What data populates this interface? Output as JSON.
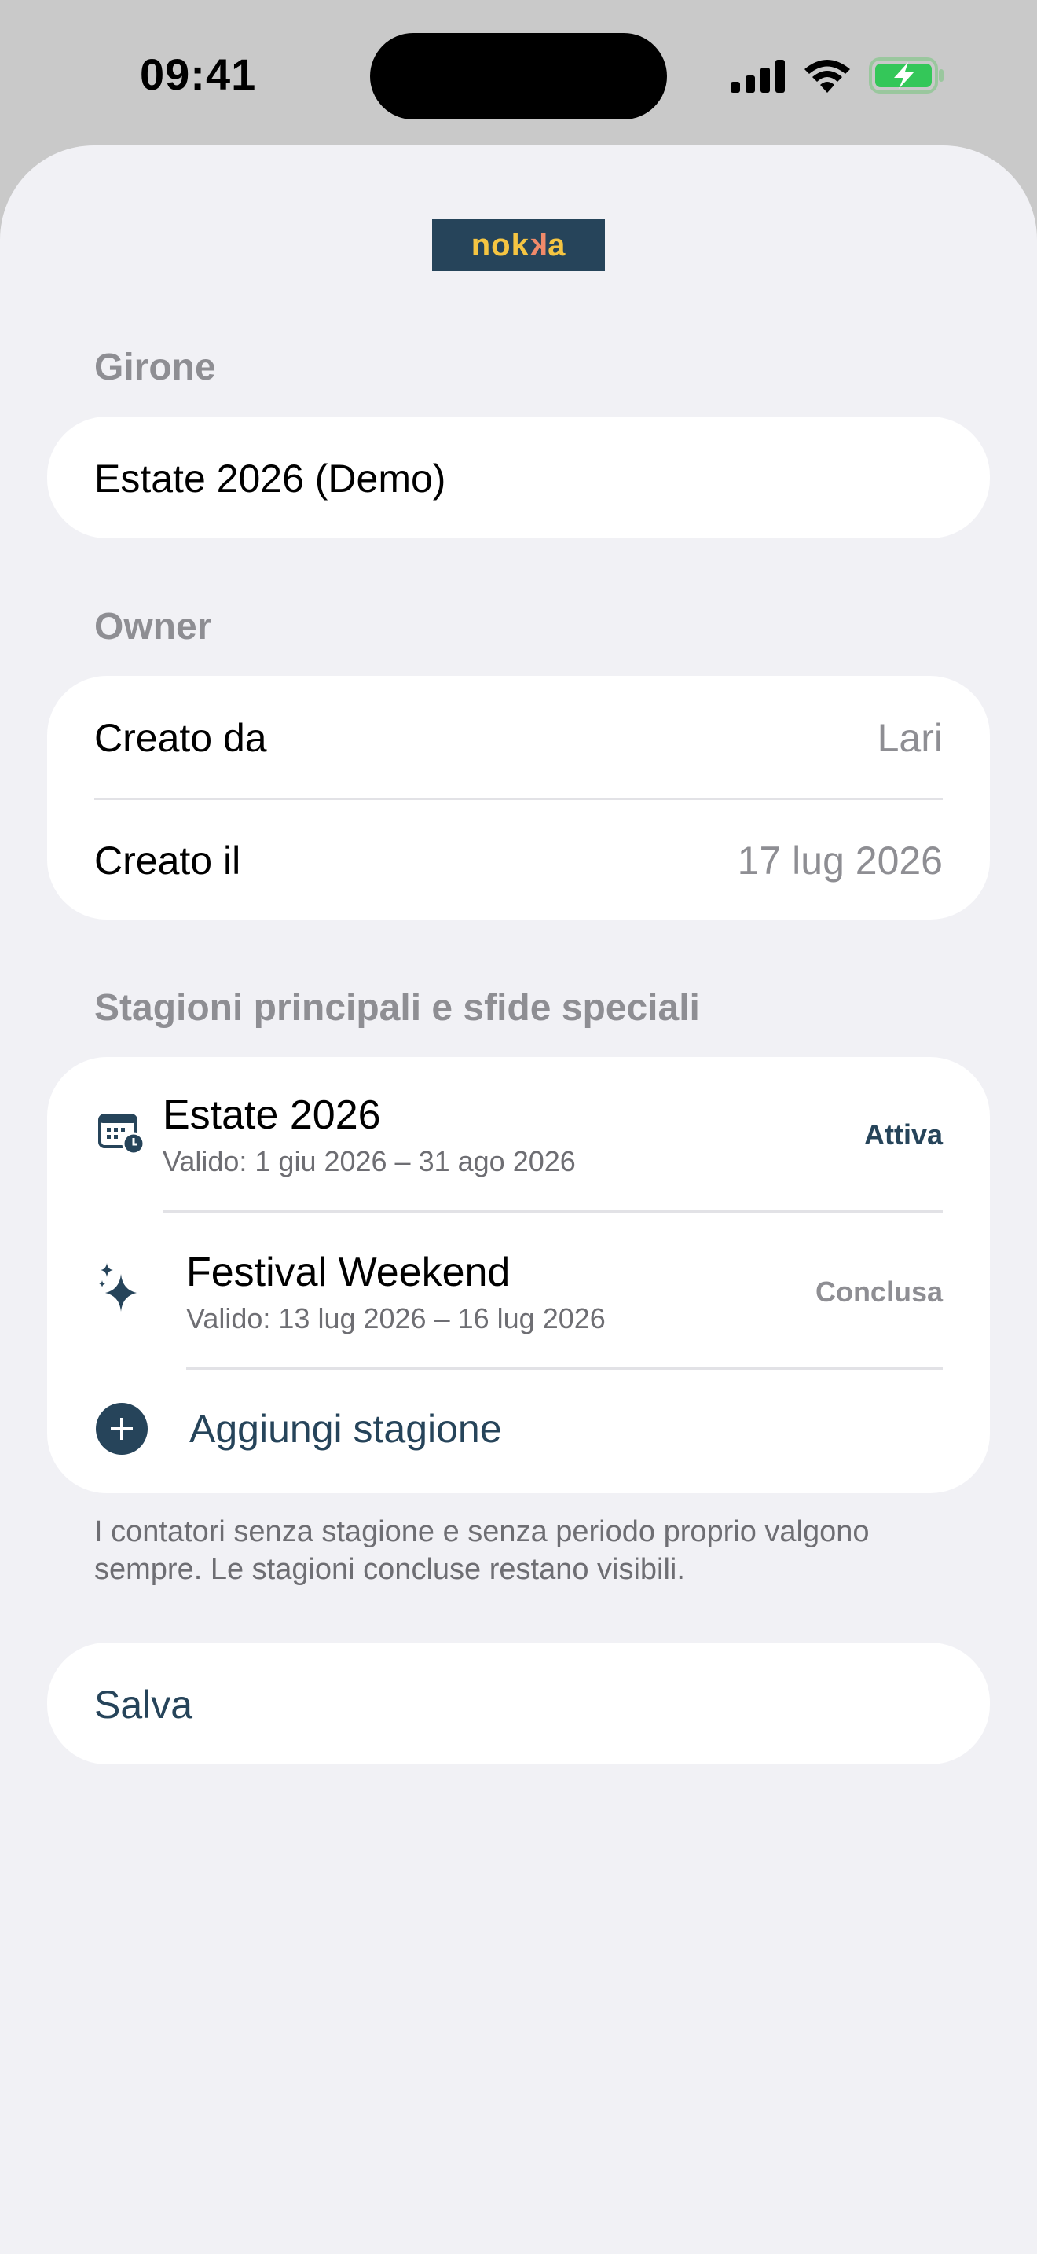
{
  "status_bar": {
    "time": "09:41"
  },
  "logo": {
    "text_a": "no",
    "text_k1": "k",
    "text_k2": "k",
    "text_b": "a"
  },
  "girone": {
    "label": "Girone",
    "name": "Estate 2026 (Demo)"
  },
  "owner": {
    "label": "Owner",
    "created_by_label": "Creato da",
    "created_by_value": "Lari",
    "created_on_label": "Creato il",
    "created_on_value": "17 lug 2026"
  },
  "seasons": {
    "label": "Stagioni principali e sfide speciali",
    "items": [
      {
        "title": "Estate 2026",
        "subtitle": "Valido: 1 giu 2026 – 31 ago 2026",
        "status": "Attiva",
        "icon": "calendar-clock-icon"
      },
      {
        "title": "Festival Weekend",
        "subtitle": "Valido: 13 lug 2026 – 16 lug 2026",
        "status": "Conclusa",
        "icon": "sparkles-icon"
      }
    ],
    "add_label": "Aggiungi stagione",
    "footnote": "I contatori senza stagione e senza periodo proprio valgono sempre. Le stagioni concluse restano visibili."
  },
  "save_label": "Salva",
  "colors": {
    "accent": "#26445a",
    "background": "#f1f1f5",
    "secondary_text": "#8e8e93",
    "battery": "#34c759"
  }
}
